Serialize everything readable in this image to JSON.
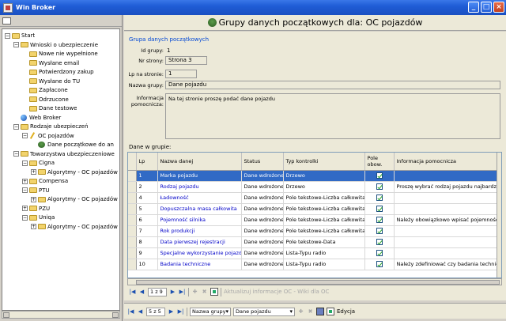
{
  "window": {
    "title": "Win Broker"
  },
  "tree": {
    "nodes": [
      {
        "label": "Start",
        "indent": 0,
        "icon": "folder-icon",
        "exp": "−"
      },
      {
        "label": "Wnioski o ubezpieczenie",
        "indent": 1,
        "icon": "folder-icon",
        "exp": "−"
      },
      {
        "label": "Nowe nie wypełnione",
        "indent": 2,
        "icon": "folder-icon",
        "exp": ""
      },
      {
        "label": "Wysłane email",
        "indent": 2,
        "icon": "folder-icon",
        "exp": ""
      },
      {
        "label": "Potwierdzony zakup",
        "indent": 2,
        "icon": "folder-icon",
        "exp": ""
      },
      {
        "label": "Wysłane do TU",
        "indent": 2,
        "icon": "folder-icon",
        "exp": ""
      },
      {
        "label": "Zapłacone",
        "indent": 2,
        "icon": "folder-icon",
        "exp": ""
      },
      {
        "label": "Odrzucone",
        "indent": 2,
        "icon": "folder-icon",
        "exp": ""
      },
      {
        "label": "Dane testowe",
        "indent": 2,
        "icon": "folder-icon",
        "exp": ""
      },
      {
        "label": "Web Broker",
        "indent": 1,
        "icon": "globe-icon",
        "exp": ""
      },
      {
        "label": "Rodzaje ubezpieczeń",
        "indent": 1,
        "icon": "folder-icon",
        "exp": "−"
      },
      {
        "label": "OC pojazdów",
        "indent": 2,
        "icon": "pencil-icon",
        "exp": "−"
      },
      {
        "label": "Dane początkowe do an",
        "indent": 3,
        "icon": "car-icon",
        "exp": ""
      },
      {
        "label": "Towarzystwa ubezpieczeniowe",
        "indent": 1,
        "icon": "folder-icon",
        "exp": "−"
      },
      {
        "label": "Cigna",
        "indent": 2,
        "icon": "folder-icon",
        "exp": "−"
      },
      {
        "label": "Algorytmy - OC pojazdów",
        "indent": 3,
        "icon": "folder-icon",
        "exp": "+"
      },
      {
        "label": "Compensa",
        "indent": 2,
        "icon": "folder-icon",
        "exp": "+"
      },
      {
        "label": "PTU",
        "indent": 2,
        "icon": "folder-icon",
        "exp": "−"
      },
      {
        "label": "Algorytmy - OC pojazdów",
        "indent": 3,
        "icon": "folder-icon",
        "exp": "+"
      },
      {
        "label": "PZU",
        "indent": 2,
        "icon": "folder-icon",
        "exp": "+"
      },
      {
        "label": "Uniqa",
        "indent": 2,
        "icon": "folder-icon",
        "exp": "−"
      },
      {
        "label": "Algorytmy - OC pojazdów",
        "indent": 3,
        "icon": "folder-icon",
        "exp": "+"
      }
    ]
  },
  "header": {
    "title": "Grupy danych początkowych dla: OC pojazdów"
  },
  "form": {
    "group_title": "Grupa danych początkowych",
    "id_label": "Id grupy:",
    "id_value": "1",
    "page_label": "Nr strony:",
    "page_value": "Strona 3",
    "lp_label": "Lp na stronie:",
    "lp_value": "1",
    "name_label": "Nazwa grupy:",
    "name_value": "Dane pojazdu",
    "info_label": "Informacja pomocnicza:",
    "info_value": "Na tej stronie proszę podać dane pojazdu",
    "grid_label": "Dane w grupie:"
  },
  "grid": {
    "headers": [
      "Lp",
      "Nazwa danej",
      "Status",
      "Typ kontrolki",
      "Pole obow.",
      "Informacja pomocnicza"
    ],
    "rows": [
      {
        "lp": "1",
        "name": "Marka pojazdu",
        "status": "Dane wdrożone",
        "type": "Drzewo",
        "req": true,
        "info": ""
      },
      {
        "lp": "2",
        "name": "Rodzaj pojazdu",
        "status": "Dane wdrożone",
        "type": "Drzewo",
        "req": true,
        "info": "Proszę wybrać rodzaj pojazdu najbardziej o"
      },
      {
        "lp": "4",
        "name": "Ładowność",
        "status": "Dane wdrożone",
        "type": "Pole tekstowe-Liczba całkowita",
        "req": true,
        "info": ""
      },
      {
        "lp": "5",
        "name": "Dopuszczalna masa całkowita",
        "status": "Dane wdrożone",
        "type": "Pole tekstowe-Liczba całkowita",
        "req": true,
        "info": ""
      },
      {
        "lp": "6",
        "name": "Pojemność silnika",
        "status": "Dane wdrożone",
        "type": "Pole tekstowe-Liczba całkowita",
        "req": true,
        "info": "Należy obowiązkowo wpisać pojemność s"
      },
      {
        "lp": "7",
        "name": "Rok produkcji",
        "status": "Dane wdrożone",
        "type": "Pole tekstowe-Liczba całkowita",
        "req": true,
        "info": ""
      },
      {
        "lp": "8",
        "name": "Data pierwszej rejestracji",
        "status": "Dane wdrożone",
        "type": "Pole tekstowe-Data",
        "req": true,
        "info": ""
      },
      {
        "lp": "9",
        "name": "Specjalne wykorzystanie pojazdu",
        "status": "Dane wdrożone",
        "type": "Lista-Typu radio",
        "req": true,
        "info": ""
      },
      {
        "lp": "10",
        "name": "Badania techniczne",
        "status": "Dane wdrożone",
        "type": "Lista-Typu radio",
        "req": true,
        "info": "Należy zdefiniować czy badania technicz"
      }
    ]
  },
  "inner_nav": {
    "position": "1 z 9",
    "extra": "Aktualizuj informacje OC - Wiki dla OC"
  },
  "bottom_nav": {
    "position": "5 z 5",
    "sort_label": "Nazwa grupy",
    "filter_value": "Dane pojazdu",
    "edit_label": "Edycja"
  },
  "colors": {
    "titlebar": "#1f5cd6",
    "selection": "#316ac5",
    "link": "#0000c8"
  }
}
